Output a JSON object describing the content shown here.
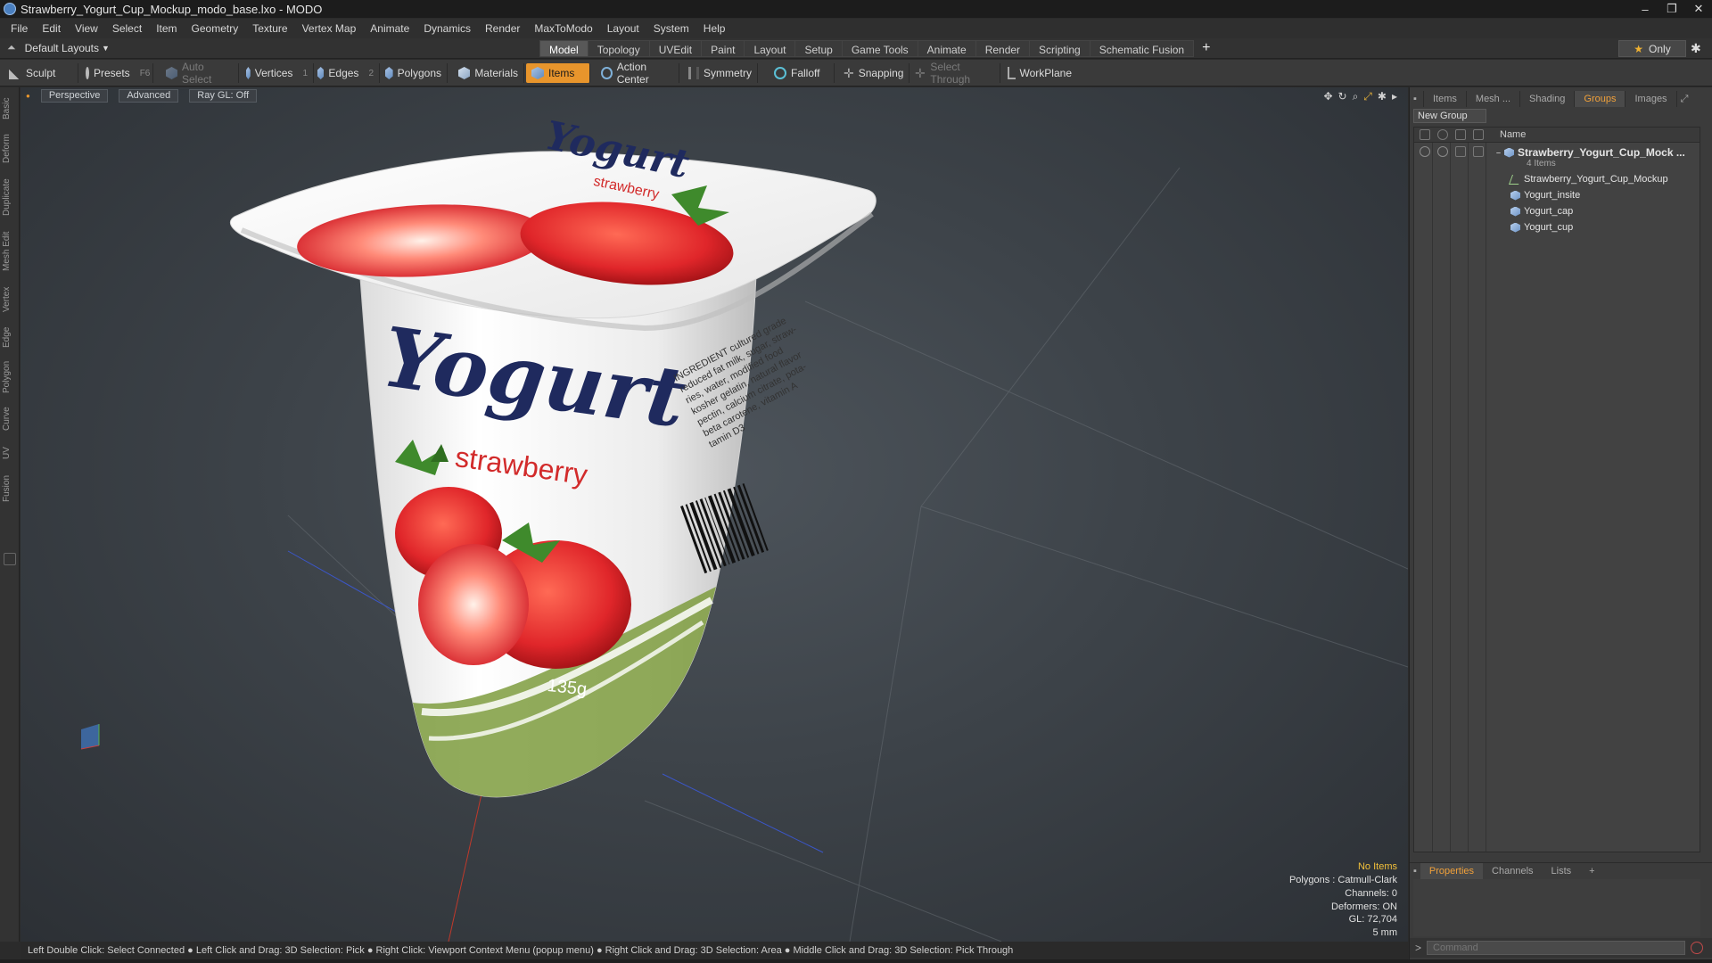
{
  "window": {
    "title": "Strawberry_Yogurt_Cup_Mockup_modo_base.lxo - MODO",
    "controls": [
      "–",
      "❐",
      "✕"
    ]
  },
  "menu": [
    "File",
    "Edit",
    "View",
    "Select",
    "Item",
    "Geometry",
    "Texture",
    "Vertex Map",
    "Animate",
    "Dynamics",
    "Render",
    "MaxToModo",
    "Layout",
    "System",
    "Help"
  ],
  "layout_selector": "Default Layouts",
  "tabs": [
    "Model",
    "Topology",
    "UVEdit",
    "Paint",
    "Layout",
    "Setup",
    "Game Tools",
    "Animate",
    "Render",
    "Scripting",
    "Schematic Fusion"
  ],
  "active_tab": "Model",
  "only_label": "Only",
  "toolbar": {
    "sculpt": "Sculpt",
    "presets": "Presets",
    "presets_hotkey": "F6",
    "auto_select": "Auto Select",
    "vertices": "Vertices",
    "vertices_hotkey": "1",
    "edges": "Edges",
    "edges_hotkey": "2",
    "polygons": "Polygons",
    "materials": "Materials",
    "items": "Items",
    "action_center": "Action Center",
    "symmetry": "Symmetry",
    "falloff": "Falloff",
    "snapping": "Snapping",
    "select_through": "Select Through",
    "workplane": "WorkPlane"
  },
  "left_tabs": [
    "Basic",
    "Deform",
    "Duplicate",
    "Mesh Edit",
    "Vertex",
    "Edge",
    "Polygon",
    "Curve",
    "UV",
    "Fusion"
  ],
  "viewport": {
    "view": "Perspective",
    "mode": "Advanced",
    "raygl": "Ray GL: Off",
    "info": {
      "no_items": "No Items",
      "polygons": "Polygons : Catmull-Clark",
      "channels": "Channels: 0",
      "deformers": "Deformers: ON",
      "gl": "GL: 72,704",
      "scale": "5 mm"
    },
    "label_yogurt": "Yogurt",
    "label_flavor": "strawberry",
    "label_weight": "135g",
    "ingredients": [
      "INGREDIENT cultured grade",
      "reduced fat milk, sugar, straw-",
      "ries, water, modified food",
      "kosher gelatin, natural flavor",
      "pectin, calcium citrate, pota-",
      "beta carotene, vitamin A",
      "tamin D3"
    ]
  },
  "status_bar": "Left Double Click: Select Connected ● Left Click and Drag: 3D Selection: Pick ● Right Click: Viewport Context Menu (popup menu) ● Right Click and Drag: 3D Selection: Area ● Middle Click and Drag: 3D Selection: Pick Through",
  "right_panel": {
    "tabs": [
      "Items",
      "Mesh ...",
      "Shading",
      "Groups",
      "Images"
    ],
    "active_tab": "Groups",
    "new_group": "New Group",
    "column_name": "Name",
    "group_name": "Strawberry_Yogurt_Cup_Mock ...",
    "group_count": "4 Items",
    "children": [
      "Strawberry_Yogurt_Cup_Mockup",
      "Yogurt_insite",
      "Yogurt_cap",
      "Yogurt_cup"
    ],
    "bottom_tabs": [
      "Properties",
      "Channels",
      "Lists"
    ],
    "bottom_active": "Properties",
    "command_placeholder": "Command"
  },
  "colors": {
    "accent": "#e8952c",
    "label_navy": "#1f2a5e",
    "label_red": "#d22b2b",
    "label_green": "#7a9a3a"
  }
}
